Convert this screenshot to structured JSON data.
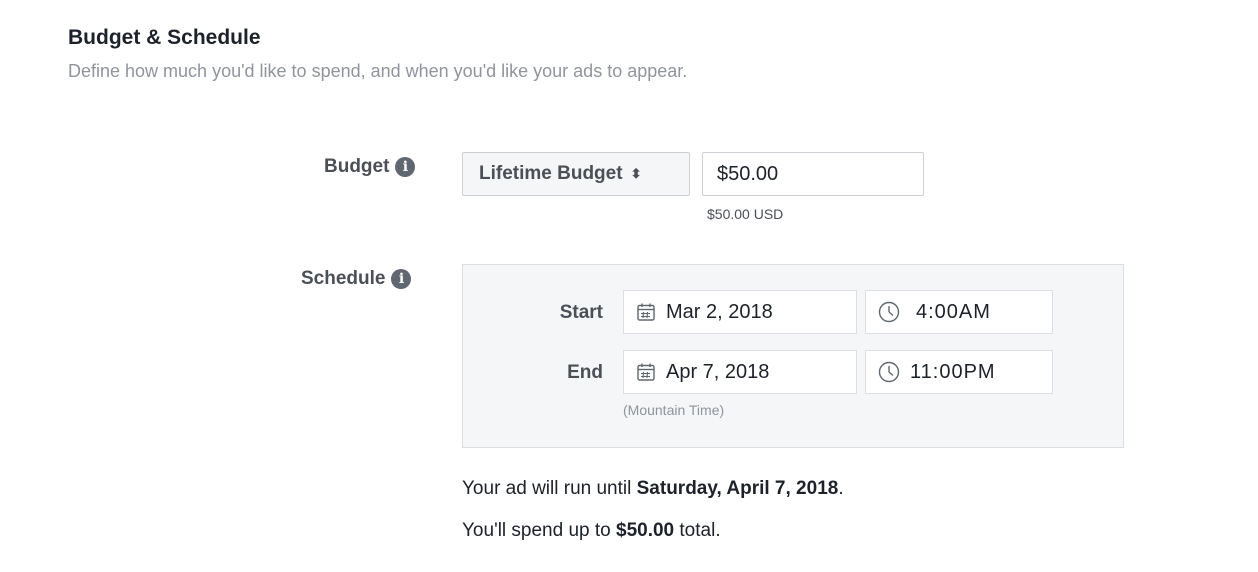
{
  "section": {
    "title": "Budget & Schedule",
    "subtitle": "Define how much you'd like to spend, and when you'd like your ads to appear."
  },
  "budget": {
    "label": "Budget",
    "type_selected": "Lifetime Budget",
    "amount": "$50.00",
    "amount_note": "$50.00 USD"
  },
  "schedule": {
    "label": "Schedule",
    "start_label": "Start",
    "start_date": "Mar 2, 2018",
    "start_time": "4:00AM",
    "end_label": "End",
    "end_date": "Apr 7, 2018",
    "end_time": "11:00PM",
    "timezone_note": "(Mountain Time)"
  },
  "summary": {
    "run_prefix": "Your ad will run until ",
    "run_date": "Saturday, April 7, 2018",
    "run_suffix": ".",
    "spend_prefix": "You'll spend up to ",
    "spend_amount": "$50.00",
    "spend_suffix": " total."
  },
  "icons": {
    "info": "info-icon",
    "calendar": "calendar-icon",
    "clock": "clock-icon",
    "select_caret": "sort-caret-icon"
  },
  "colors": {
    "text": "#1d2129",
    "muted": "#90949c",
    "label": "#4b4f56",
    "border": "#ccd0d5",
    "panel_bg": "#f5f6f7"
  }
}
